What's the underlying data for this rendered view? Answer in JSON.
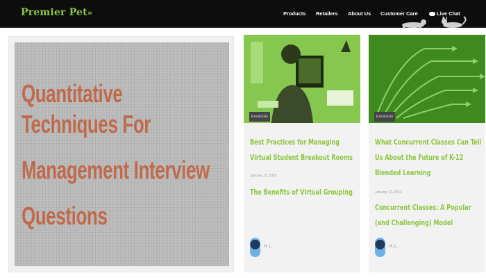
{
  "header": {
    "logo": "Premier Pet",
    "nav": [
      "Products",
      "Retailers",
      "About Us",
      "Customer Care",
      "Live Chat"
    ]
  },
  "hero": {
    "title_lines": [
      "Quantitative Techniques For",
      "Management Interview",
      "Questions"
    ]
  },
  "cards": [
    {
      "tag": "EnviroGlo",
      "title": "Best Practices for Managing Virtual Student Breakout Rooms",
      "date": "January 13, 2022",
      "subtitle": "The Benefits of Virtual Grouping",
      "author": "H. L."
    },
    {
      "tag": "EnviroGlo",
      "title": "What Concurrent Classes Can Tell Us About the Future of K-12 Blended Learning",
      "date": "January 11, 2022",
      "subtitle": "Concurrent Classes: A Popular (and Challenging) Model",
      "author": "H. L."
    }
  ],
  "colors": {
    "accent": "#8cc63f",
    "header_bg": "#0d0d0d",
    "hero_text": "#c06a4b"
  }
}
